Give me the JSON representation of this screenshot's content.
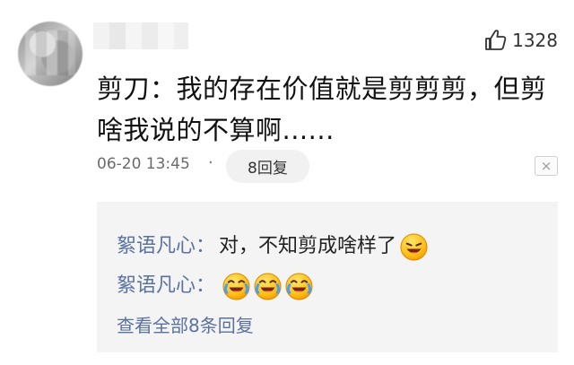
{
  "comment": {
    "likes": "1328",
    "text": "剪刀：我的存在价值就是剪剪剪，但剪啥我说的不算啊......",
    "timestamp": "06-20 13:45",
    "separator": "·",
    "reply_button": "8回复",
    "close_symbol": "×"
  },
  "replies": [
    {
      "user": "絮语凡心",
      "colon": "：",
      "text": "对，不知剪成啥样了"
    },
    {
      "user": "絮语凡心",
      "colon": "：",
      "text": ""
    }
  ],
  "view_more": "查看全部8条回复",
  "icons": {
    "like": "thumbs-up-icon",
    "close": "close-icon",
    "emoji1": "laughing-emoji-icon",
    "emoji2": "crying-laughing-emoji-icon"
  },
  "colors": {
    "link": "#5a72a0",
    "reply_bg": "#f4f4f4",
    "text": "#111111",
    "meta": "#6b6b6b"
  }
}
